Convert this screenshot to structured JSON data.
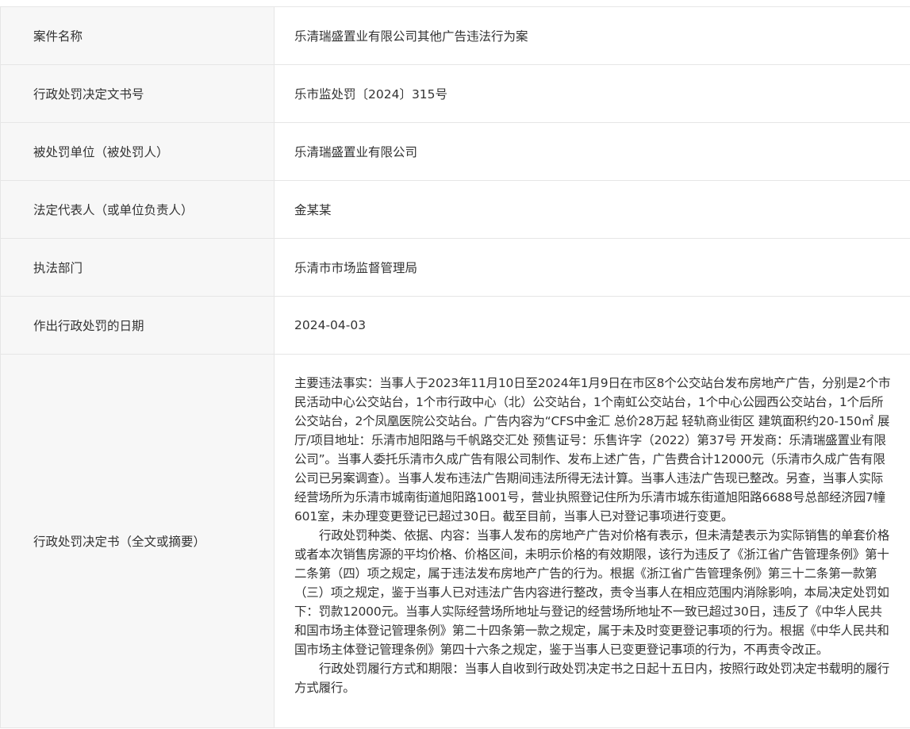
{
  "rows": [
    {
      "label": "案件名称",
      "value": "乐清瑞盛置业有限公司其他广告违法行为案"
    },
    {
      "label": "行政处罚决定文书号",
      "value": "乐市监处罚〔2024〕315号"
    },
    {
      "label": "被处罚单位（被处罚人）",
      "value": "乐清瑞盛置业有限公司"
    },
    {
      "label": "法定代表人（或单位负责人）",
      "value": "金某某"
    },
    {
      "label": "执法部门",
      "value": "乐清市市场监督管理局"
    },
    {
      "label": "作出行政处罚的日期",
      "value": "2024-04-03"
    }
  ],
  "decision": {
    "label": "行政处罚决定书（全文或摘要）",
    "paragraphs": [
      "主要违法事实：当事人于2023年11月10日至2024年1月9日在市区8个公交站台发布房地产广告，分别是2个市民活动中心公交站台，1个市行政中心（北）公交站台，1个南虹公交站台，1个中心公园西公交站台，1个后所公交站台，2个凤凰医院公交站台。广告内容为“CFS中金汇 总价28万起 轻轨商业街区 建筑面积约20-150㎡ 展厅/项目地址：乐清市旭阳路与千帆路交汇处 预售证号：乐售许字（2022）第37号 开发商：乐清瑞盛置业有限公司”。当事人委托乐清市久成广告有限公司制作、发布上述广告，广告费合计12000元（乐清市久成广告有限公司已另案调查）。当事人发布违法广告期间违法所得无法计算。当事人违法广告现已整改。另查，当事人实际经营场所为乐清市城南街道旭阳路1001号，营业执照登记住所为乐清市城东街道旭阳路6688号总部经济园7幢601室，未办理变更登记已超过30日。截至目前，当事人已对登记事项进行变更。",
      "行政处罚种类、依据、内容：当事人发布的房地产广告对价格有表示，但未清楚表示为实际销售的单套价格或者本次销售房源的平均价格、价格区间，未明示价格的有效期限，该行为违反了《浙江省广告管理条例》第十二条第（四）项之规定，属于违法发布房地产广告的行为。根据《浙江省广告管理条例》第三十二条第一款第（三）项之规定，鉴于当事人已对违法广告内容进行整改，责令当事人在相应范围内消除影响，本局决定处罚如下：罚款12000元。当事人实际经营场所地址与登记的经营场所地址不一致已超过30日，违反了《中华人民共和国市场主体登记管理条例》第二十四条第一款之规定，属于未及时变更登记事项的行为。根据《中华人民共和国市场主体登记管理条例》第四十六条之规定，鉴于当事人已变更登记事项的行为，不再责令改正。",
      "行政处罚履行方式和期限：当事人自收到行政处罚决定书之日起十五日内，按照行政处罚决定书载明的履行方式履行。"
    ]
  }
}
